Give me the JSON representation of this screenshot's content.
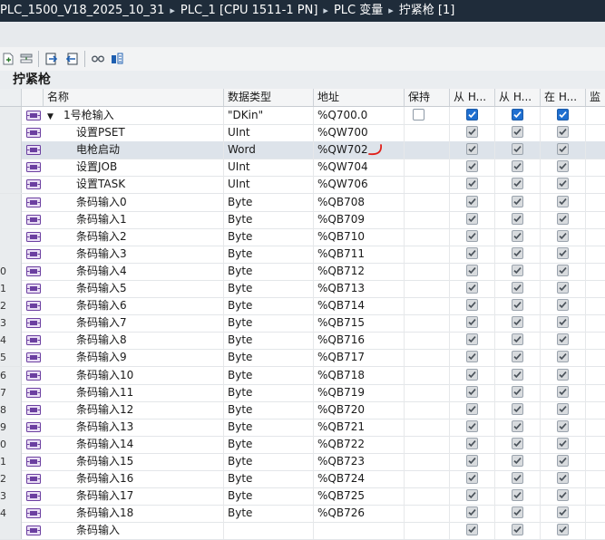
{
  "titlebar": {
    "crumbs": [
      "PLC_1500_V18_2025_10_31",
      "PLC_1 [CPU 1511-1 PN]",
      "PLC 变量",
      "拧紧枪 [1]"
    ],
    "separator": "▸"
  },
  "panel": {
    "title": "拧紧枪"
  },
  "columns": {
    "name": "名称",
    "type": "数据类型",
    "address": "地址",
    "retain": "保持",
    "from_hmi1": "从 H...",
    "from_hmi2": "从 H...",
    "in_hmi": "在 H...",
    "monitor": "监"
  },
  "rows": [
    {
      "num": "",
      "name": "1号枪输入",
      "type": "\"DKin\"",
      "address": "%Q700.0",
      "expand": true,
      "level": 0,
      "retain_box": true,
      "style": "blue"
    },
    {
      "num": "",
      "name": "设置PSET",
      "type": "UInt",
      "address": "%QW700",
      "level": 1,
      "style": "gray"
    },
    {
      "num": "",
      "name": "电枪启动",
      "type": "Word",
      "address": "%QW702",
      "level": 1,
      "style": "gray",
      "selected": true,
      "mark": true
    },
    {
      "num": "",
      "name": "设置JOB",
      "type": "UInt",
      "address": "%QW704",
      "level": 1,
      "style": "gray"
    },
    {
      "num": "",
      "name": "设置TASK",
      "type": "UInt",
      "address": "%QW706",
      "level": 1,
      "style": "gray"
    },
    {
      "num": "",
      "name": "条码输入0",
      "type": "Byte",
      "address": "%QB708",
      "level": 1,
      "style": "gray"
    },
    {
      "num": "",
      "name": "条码输入1",
      "type": "Byte",
      "address": "%QB709",
      "level": 1,
      "style": "gray"
    },
    {
      "num": "",
      "name": "条码输入2",
      "type": "Byte",
      "address": "%QB710",
      "level": 1,
      "style": "gray"
    },
    {
      "num": "",
      "name": "条码输入3",
      "type": "Byte",
      "address": "%QB711",
      "level": 1,
      "style": "gray"
    },
    {
      "num": "0",
      "name": "条码输入4",
      "type": "Byte",
      "address": "%QB712",
      "level": 1,
      "style": "gray"
    },
    {
      "num": "1",
      "name": "条码输入5",
      "type": "Byte",
      "address": "%QB713",
      "level": 1,
      "style": "gray"
    },
    {
      "num": "2",
      "name": "条码输入6",
      "type": "Byte",
      "address": "%QB714",
      "level": 1,
      "style": "gray"
    },
    {
      "num": "3",
      "name": "条码输入7",
      "type": "Byte",
      "address": "%QB715",
      "level": 1,
      "style": "gray"
    },
    {
      "num": "4",
      "name": "条码输入8",
      "type": "Byte",
      "address": "%QB716",
      "level": 1,
      "style": "gray"
    },
    {
      "num": "5",
      "name": "条码输入9",
      "type": "Byte",
      "address": "%QB717",
      "level": 1,
      "style": "gray"
    },
    {
      "num": "6",
      "name": "条码输入10",
      "type": "Byte",
      "address": "%QB718",
      "level": 1,
      "style": "gray"
    },
    {
      "num": "7",
      "name": "条码输入11",
      "type": "Byte",
      "address": "%QB719",
      "level": 1,
      "style": "gray"
    },
    {
      "num": "8",
      "name": "条码输入12",
      "type": "Byte",
      "address": "%QB720",
      "level": 1,
      "style": "gray"
    },
    {
      "num": "9",
      "name": "条码输入13",
      "type": "Byte",
      "address": "%QB721",
      "level": 1,
      "style": "gray"
    },
    {
      "num": "0",
      "name": "条码输入14",
      "type": "Byte",
      "address": "%QB722",
      "level": 1,
      "style": "gray"
    },
    {
      "num": "1",
      "name": "条码输入15",
      "type": "Byte",
      "address": "%QB723",
      "level": 1,
      "style": "gray"
    },
    {
      "num": "2",
      "name": "条码输入16",
      "type": "Byte",
      "address": "%QB724",
      "level": 1,
      "style": "gray"
    },
    {
      "num": "3",
      "name": "条码输入17",
      "type": "Byte",
      "address": "%QB725",
      "level": 1,
      "style": "gray"
    },
    {
      "num": "4",
      "name": "条码输入18",
      "type": "Byte",
      "address": "%QB726",
      "level": 1,
      "style": "gray"
    },
    {
      "num": "",
      "name": "条码输入",
      "type": "",
      "address": "",
      "level": 1,
      "style": "gray"
    }
  ],
  "colors": {
    "titlebar_bg": "#1f2c3a",
    "checkbox_blue": "#1f6fd0",
    "checkbox_gray": "#d8dbde",
    "mark_red": "#e0201a",
    "icon_purple": "#6b3fa0"
  },
  "icons": {
    "toolbar": [
      "add-tag-icon",
      "insert-row-icon",
      "export-icon",
      "import-icon",
      "monitor-glasses-icon",
      "watch-table-icon"
    ],
    "row_tag_icon": "io-tag-icon",
    "expand": "triangle-down-icon"
  }
}
